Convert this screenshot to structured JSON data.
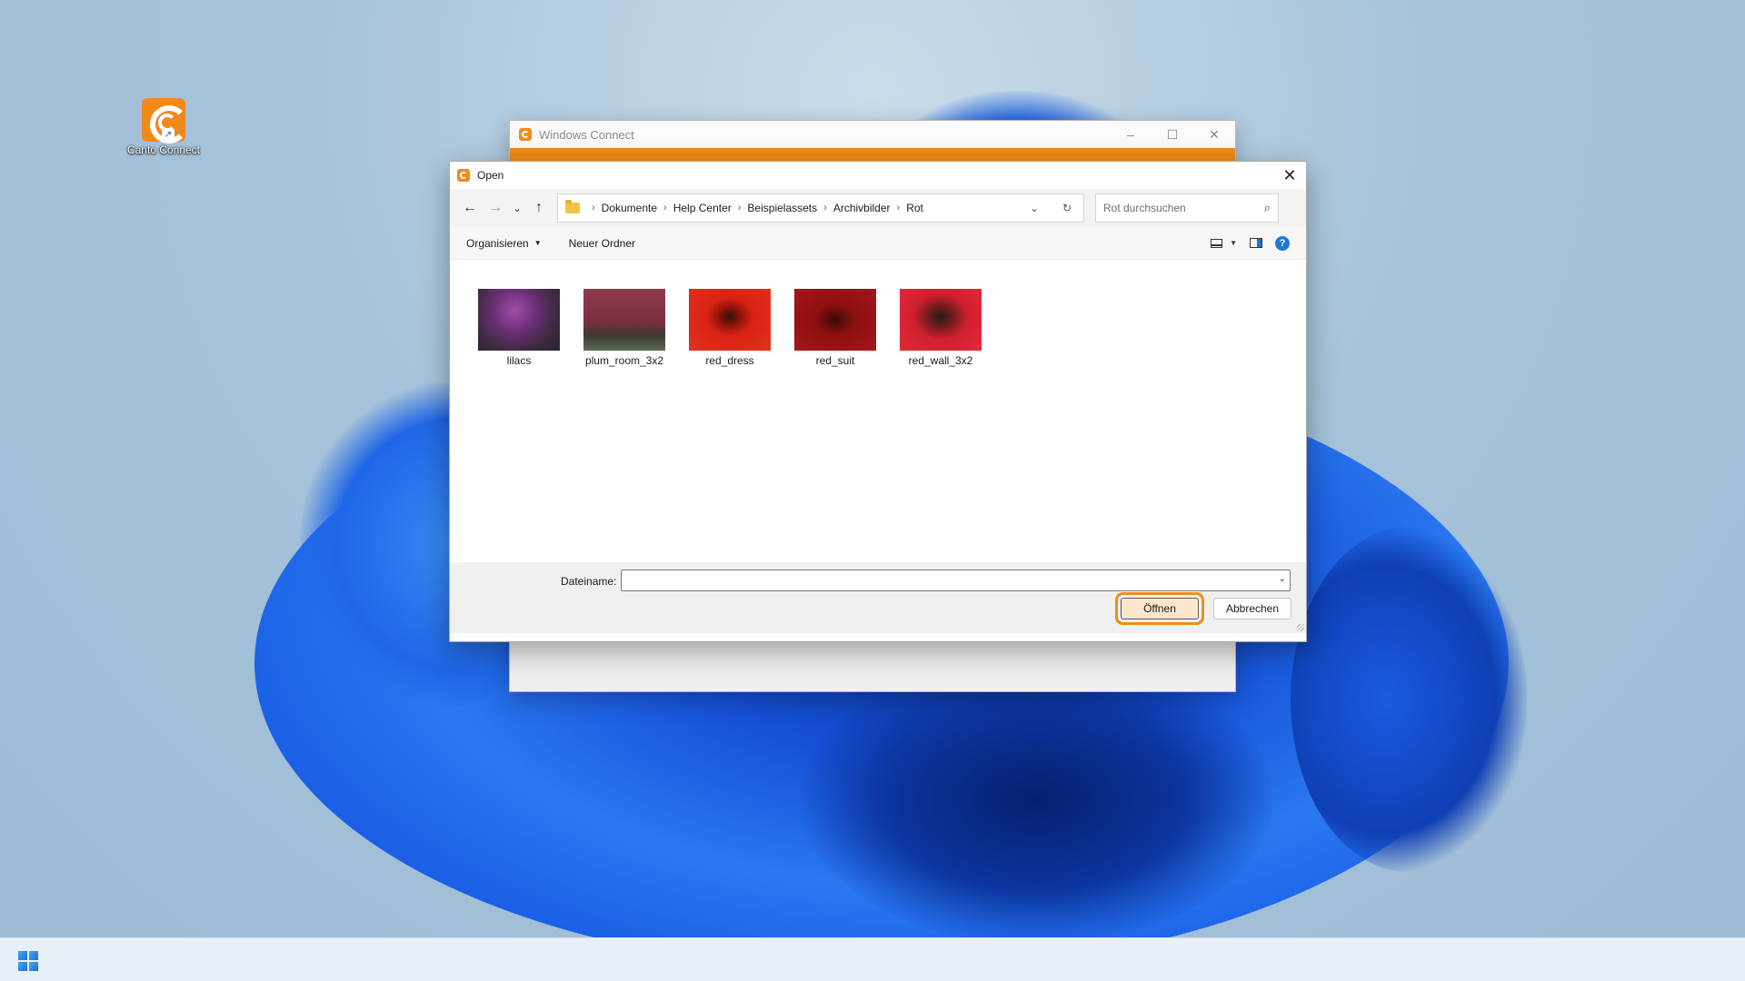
{
  "desktop": {
    "icon_label": "Canto Connect"
  },
  "background_window": {
    "title": "Windows Connect",
    "controls": [
      "–",
      "☐",
      "✕"
    ]
  },
  "dialog": {
    "title": "Open",
    "breadcrumb": [
      "Dokumente",
      "Help Center",
      "Beispielassets",
      "Archivbilder",
      "Rot"
    ],
    "search_placeholder": "Rot durchsuchen",
    "toolbar": {
      "organize": "Organisieren",
      "new_folder": "Neuer Ordner"
    },
    "files": [
      {
        "name": "lilacs"
      },
      {
        "name": "plum_room_3x2"
      },
      {
        "name": "red_dress"
      },
      {
        "name": "red_suit"
      },
      {
        "name": "red_wall_3x2"
      }
    ],
    "filename_label": "Dateiname:",
    "filename_value": "",
    "open_button": "Öffnen",
    "cancel_button": "Abbrechen"
  },
  "colors": {
    "accent_orange": "#f28c1a",
    "open_button_bg": "#fde6cc",
    "help_blue": "#1a7ad9"
  }
}
